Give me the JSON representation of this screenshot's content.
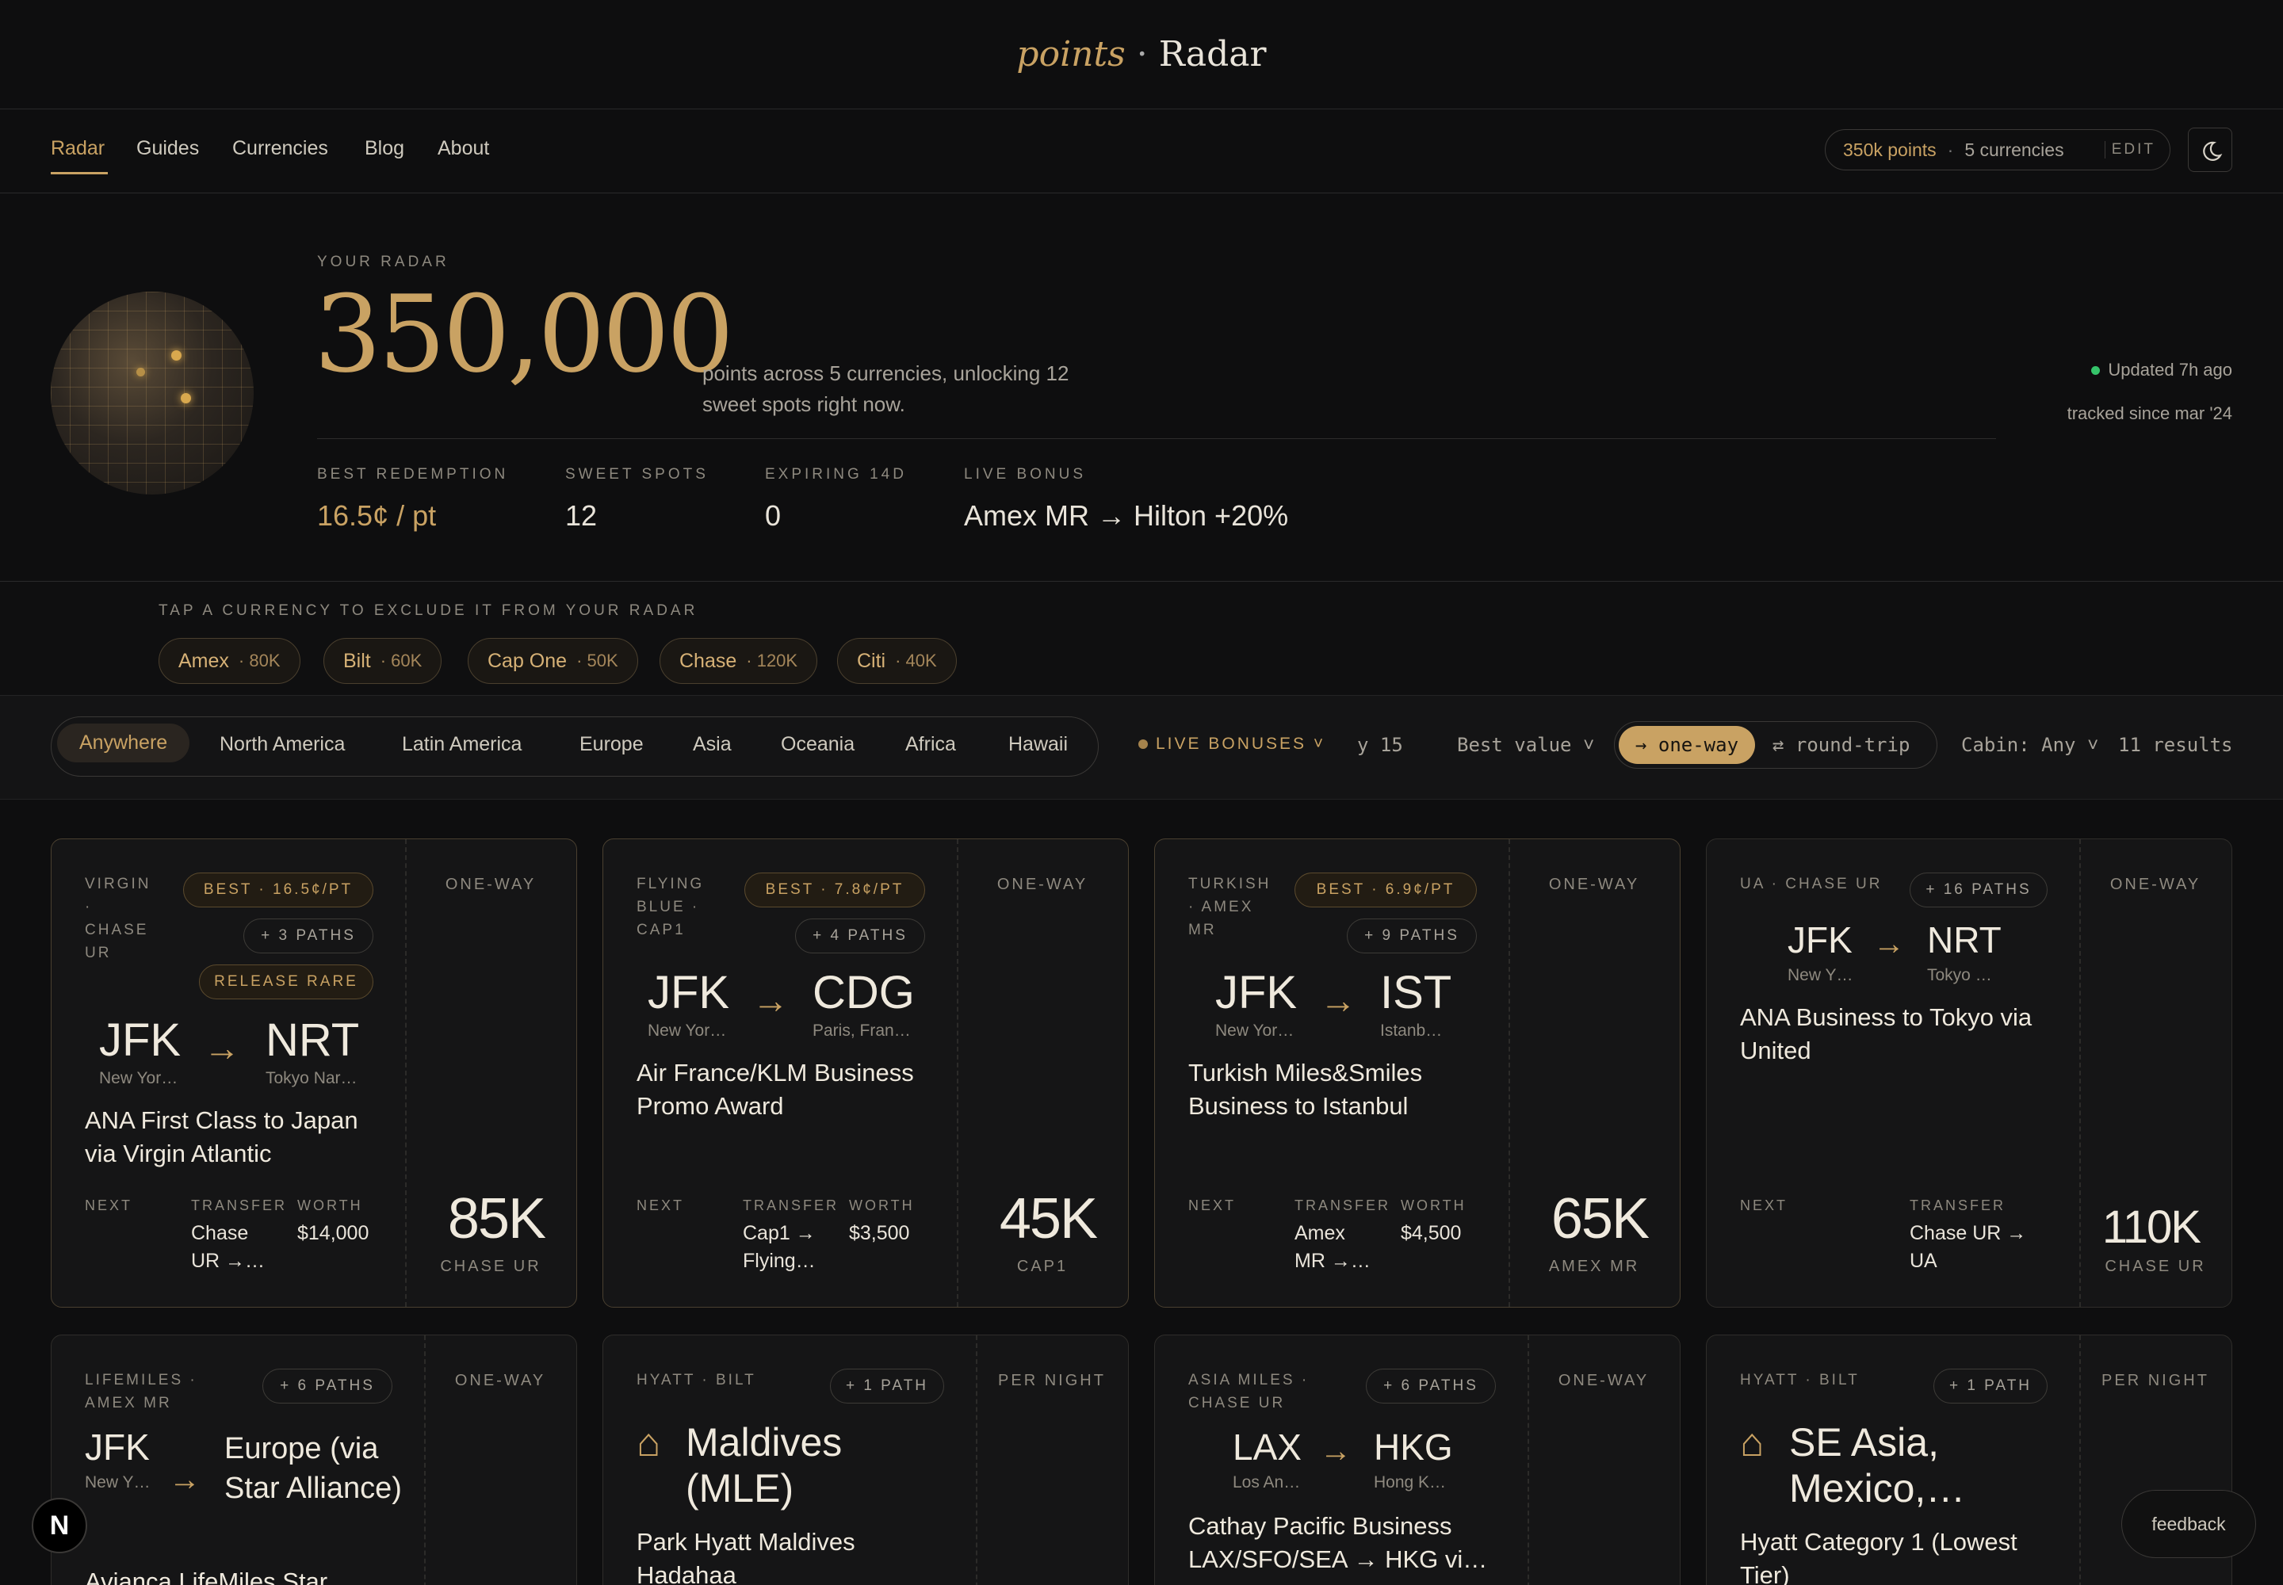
{
  "brand": {
    "accent": "points",
    "dot": "·",
    "name": "Radar"
  },
  "nav": {
    "items": [
      "Radar",
      "Guides",
      "Currencies",
      "Blog",
      "About"
    ],
    "active": "Radar"
  },
  "account": {
    "points": "350k points",
    "currencies": "5 currencies",
    "edit": "EDIT"
  },
  "radar": {
    "label": "YOUR RADAR",
    "total": "350,000",
    "desc": "points across 5 currencies, unlocking 12 sweet spots right now.",
    "updated": "Updated 7h ago",
    "tracked": "tracked since mar '24",
    "stats": [
      {
        "label": "BEST REDEMPTION",
        "value": "16.5¢ / pt"
      },
      {
        "label": "SWEET SPOTS",
        "value": "12"
      },
      {
        "label": "EXPIRING 14D",
        "value": "0"
      },
      {
        "label": "LIVE BONUS",
        "value": "Amex MR → Hilton +20%"
      }
    ]
  },
  "currencies": {
    "hint": "TAP A CURRENCY TO EXCLUDE IT FROM YOUR RADAR",
    "chips": [
      {
        "name": "Amex",
        "amount": "· 80K"
      },
      {
        "name": "Bilt",
        "amount": "· 60K"
      },
      {
        "name": "Cap One",
        "amount": "· 50K"
      },
      {
        "name": "Chase",
        "amount": "· 120K"
      },
      {
        "name": "Citi",
        "amount": "· 40K"
      }
    ]
  },
  "filters": {
    "regions": [
      "Anywhere",
      "North America",
      "Latin America",
      "Europe",
      "Asia",
      "Oceania",
      "Africa",
      "Hawaii"
    ],
    "live_bonuses": "LIVE BONUSES ˅",
    "extra": "y 15",
    "sort": "Best value ˅",
    "oneway": "→ one-way",
    "roundtrip": "⇄ round-trip",
    "cabin": "Cabin: Any ˅",
    "results": "11 results"
  },
  "cards": [
    {
      "tag": "VIRGIN · CHASE UR",
      "best": "BEST · 16.5¢/PT",
      "paths": "+ 3 PATHS",
      "rare": "RELEASE RARE",
      "from": "JFK",
      "from_city": "New Yor…",
      "to": "NRT",
      "to_city": "Tokyo Nar…",
      "title": "ANA First Class to Japan via Virgin Atlantic",
      "next": "NEXT",
      "transfer_lbl": "TRANSFER",
      "transfer": "Chase UR →…",
      "worth_lbl": "WORTH",
      "worth": "$14,000",
      "type": "ONE-WAY",
      "price": "85K",
      "unit": "CHASE UR"
    },
    {
      "tag": "FLYING BLUE · CAP1",
      "best": "BEST · 7.8¢/PT",
      "paths": "+ 4 PATHS",
      "from": "JFK",
      "from_city": "New Yor…",
      "to": "CDG",
      "to_city": "Paris, Fran…",
      "title": "Air France/KLM Business Promo Award",
      "next": "NEXT",
      "transfer_lbl": "TRANSFER",
      "transfer": "Cap1 → Flying…",
      "worth_lbl": "WORTH",
      "worth": "$3,500",
      "type": "ONE-WAY",
      "price": "45K",
      "unit": "CAP1"
    },
    {
      "tag": "TURKISH · AMEX MR",
      "best": "BEST · 6.9¢/PT",
      "paths": "+ 9 PATHS",
      "from": "JFK",
      "from_city": "New Yor…",
      "to": "IST",
      "to_city": "Istanb…",
      "title": "Turkish Miles&Smiles Business to Istanbul",
      "next": "NEXT",
      "transfer_lbl": "TRANSFER",
      "transfer": "Amex MR →…",
      "worth_lbl": "WORTH",
      "worth": "$4,500",
      "type": "ONE-WAY",
      "price": "65K",
      "unit": "AMEX MR"
    },
    {
      "tag": "UA · CHASE UR",
      "paths": "+ 16 PATHS",
      "from": "JFK",
      "from_city": "New Y…",
      "to": "NRT",
      "to_city": "Tokyo …",
      "title": "ANA Business to Tokyo via United",
      "next": "NEXT",
      "transfer_lbl": "TRANSFER",
      "transfer": "Chase UR → UA",
      "type": "ONE-WAY",
      "price": "110K",
      "unit": "CHASE UR"
    },
    {
      "tag": "LIFEMILES · AMEX MR",
      "paths": "+ 6 PATHS",
      "from": "JFK",
      "from_city": "New Y…",
      "to": "Europe (via Star Alliance)",
      "title": "Avianca LifeMiles Star",
      "type": "ONE-WAY"
    },
    {
      "tag": "HYATT · BILT",
      "paths": "+ 1 PATH",
      "icon": "⌂",
      "to": "Maldives (MLE)",
      "title": "Park Hyatt Maldives Hadahaa",
      "type": "PER NIGHT"
    },
    {
      "tag": "ASIA MILES · CHASE UR",
      "paths": "+ 6 PATHS",
      "from": "LAX",
      "from_city": "Los An…",
      "to": "HKG",
      "to_city": "Hong K…",
      "title": "Cathay Pacific Business LAX/SFO/SEA → HKG vi…",
      "type": "ONE-WAY"
    },
    {
      "tag": "HYATT · BILT",
      "paths": "+ 1 PATH",
      "icon": "⌂",
      "to": "SE Asia, Mexico,…",
      "title": "Hyatt Category 1 (Lowest Tier)",
      "type": "PER NIGHT"
    }
  ],
  "corner": {
    "logo": "N",
    "feedback": "feedback"
  },
  "colors": {
    "accent": "#c9a263",
    "background": "#0e0e0f",
    "live": "#35c46a"
  }
}
